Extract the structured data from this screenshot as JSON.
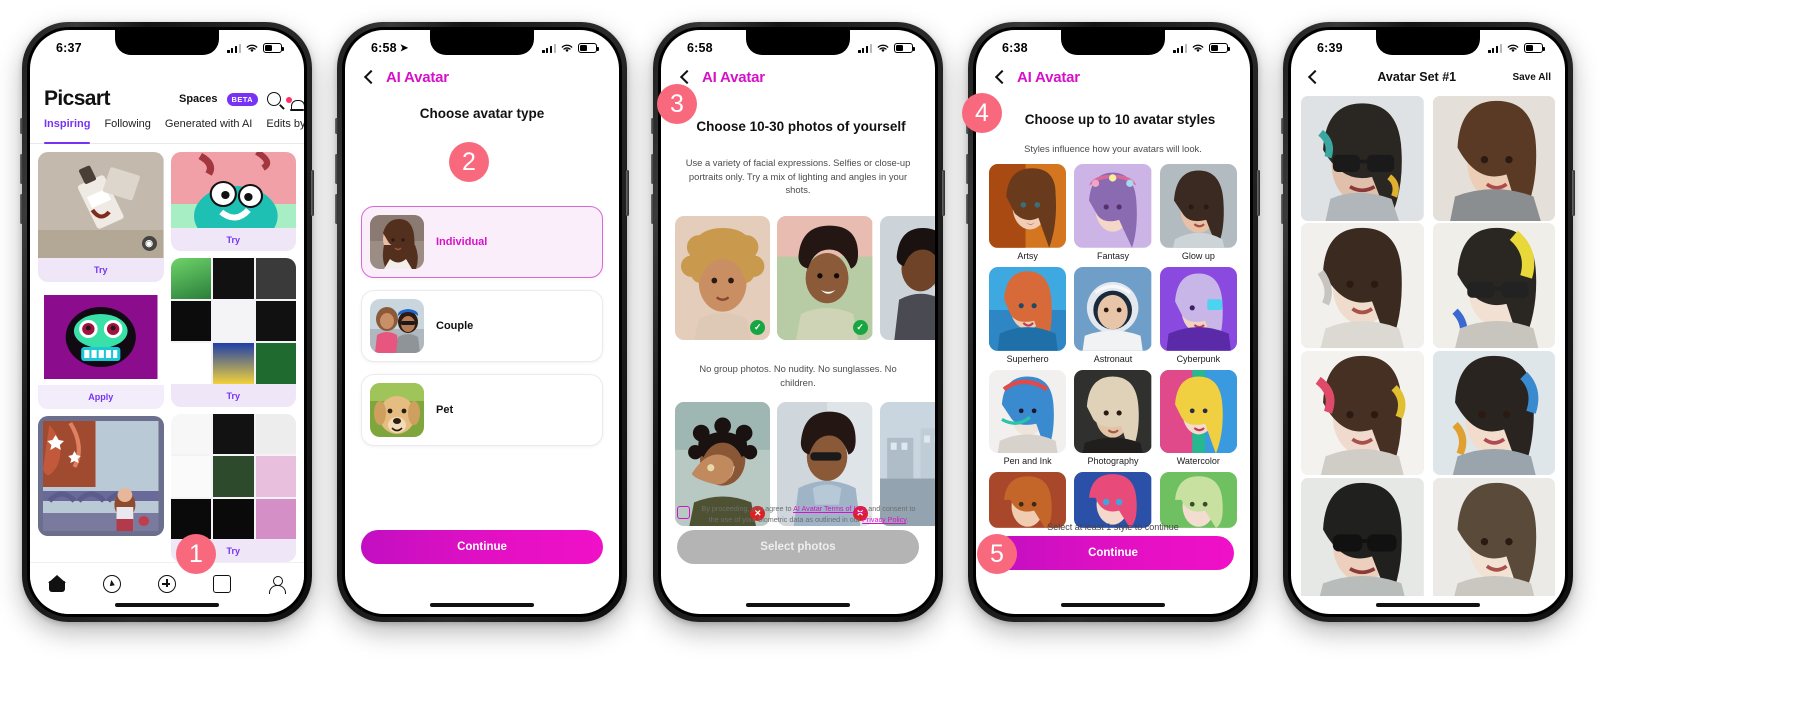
{
  "screens": [
    {
      "id": "feed",
      "status": {
        "time": "6:37",
        "location_arrow": false
      },
      "brand": "Picsart",
      "spaces_label": "Spaces",
      "beta_badge": "BETA",
      "tabs": [
        {
          "label": "Inspiring",
          "active": true
        },
        {
          "label": "Following",
          "active": false
        },
        {
          "label": "Generated with AI",
          "active": false
        },
        {
          "label": "Edits by Me",
          "active": false
        }
      ],
      "cards": [
        {
          "action": "Try"
        },
        {
          "action": "Apply"
        },
        {
          "action": "Try"
        },
        {
          "action": "Try"
        },
        {
          "action": "Try"
        }
      ],
      "tabbar": [
        "home-icon",
        "compass-icon",
        "plus-icon",
        "store-icon",
        "person-icon"
      ],
      "step_badge": "1"
    },
    {
      "id": "choose-type",
      "status": {
        "time": "6:58",
        "location_arrow": true
      },
      "app_title": "AI Avatar",
      "heading": "Choose avatar type",
      "step_badge": "2",
      "options": [
        {
          "label": "Individual",
          "selected": true
        },
        {
          "label": "Couple",
          "selected": false
        },
        {
          "label": "Pet",
          "selected": false
        }
      ],
      "cta": "Continue"
    },
    {
      "id": "choose-photos",
      "status": {
        "time": "6:58",
        "location_arrow": false
      },
      "app_title": "AI Avatar",
      "heading": "Choose 10-30 photos of yourself",
      "subtext": "Use a variety of facial expressions. Selfies or close-up portraits only. Try a mix of lighting and angles in your shots.",
      "rule_text": "No group photos. No nudity. No sunglasses. No children.",
      "step_badge": "3",
      "good_photos": [
        {
          "mark": "ok"
        },
        {
          "mark": "ok"
        },
        {
          "mark": "none"
        }
      ],
      "bad_photos": [
        {
          "mark": "no"
        },
        {
          "mark": "no"
        },
        {
          "mark": "none"
        }
      ],
      "terms": {
        "part1": "By proceeding, you agree to ",
        "link1": "AI Avatar Terms of Use",
        "part2": " and consent to the use of your biometric data as outlined in our ",
        "link2": "Privacy Policy",
        "part3": "."
      },
      "cta": "Select photos",
      "cta_disabled": true
    },
    {
      "id": "choose-styles",
      "status": {
        "time": "6:38",
        "location_arrow": false
      },
      "app_title": "AI Avatar",
      "heading": "Choose up to 10 avatar styles",
      "subtext": "Styles influence how your avatars will look.",
      "step_badge": "4",
      "styles": [
        {
          "name": "Artsy"
        },
        {
          "name": "Fantasy"
        },
        {
          "name": "Glow up"
        },
        {
          "name": "Superhero"
        },
        {
          "name": "Astronaut"
        },
        {
          "name": "Cyberpunk"
        },
        {
          "name": "Pen and Ink"
        },
        {
          "name": "Photography"
        },
        {
          "name": "Watercolor"
        },
        {
          "name": ""
        },
        {
          "name": ""
        },
        {
          "name": ""
        }
      ],
      "hint": "Select at least 1 style to continue",
      "cta": "Continue",
      "cta_step_badge": "5"
    },
    {
      "id": "avatar-set",
      "status": {
        "time": "6:39",
        "location_arrow": false
      },
      "title": "Avatar Set #1",
      "save_all": "Save All",
      "results_count": 8
    }
  ],
  "colors": {
    "brand_magenta": "#d612c8",
    "brand_purple": "#7633f5",
    "step_badge": "#f8697e",
    "ok_green": "#18a642",
    "no_red": "#e02020"
  }
}
